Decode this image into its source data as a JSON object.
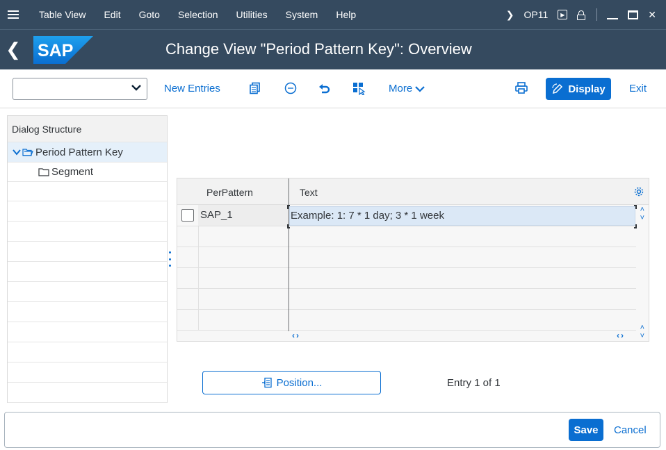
{
  "menubar": {
    "items": [
      "Table View",
      "Edit",
      "Goto",
      "Selection",
      "Utilities",
      "System",
      "Help"
    ],
    "tcode": "OP11"
  },
  "titlebar": {
    "logo_text": "SAP",
    "title": "Change View \"Period Pattern Key\": Overview"
  },
  "toolbar": {
    "command_value": "",
    "new_entries": "New Entries",
    "more": "More",
    "display": "Display",
    "exit": "Exit"
  },
  "dialog_structure": {
    "header": "Dialog Structure",
    "items": [
      {
        "label": "Period Pattern Key",
        "selected": true,
        "icon": "folder-open-icon"
      },
      {
        "label": "Segment",
        "selected": false,
        "icon": "folder-icon"
      }
    ]
  },
  "table": {
    "columns": [
      "PerPattern",
      "Text"
    ],
    "rows": [
      {
        "key": "SAP_1",
        "text": "Example: 1: 7 * 1 day; 3 * 1 week"
      }
    ]
  },
  "position_button": "Position...",
  "entry_info": "Entry 1 of 1",
  "footer": {
    "save": "Save",
    "cancel": "Cancel"
  },
  "colors": {
    "shell": "#354a5f",
    "accent": "#0a6ed1",
    "selected_row": "#dbe8f6"
  }
}
